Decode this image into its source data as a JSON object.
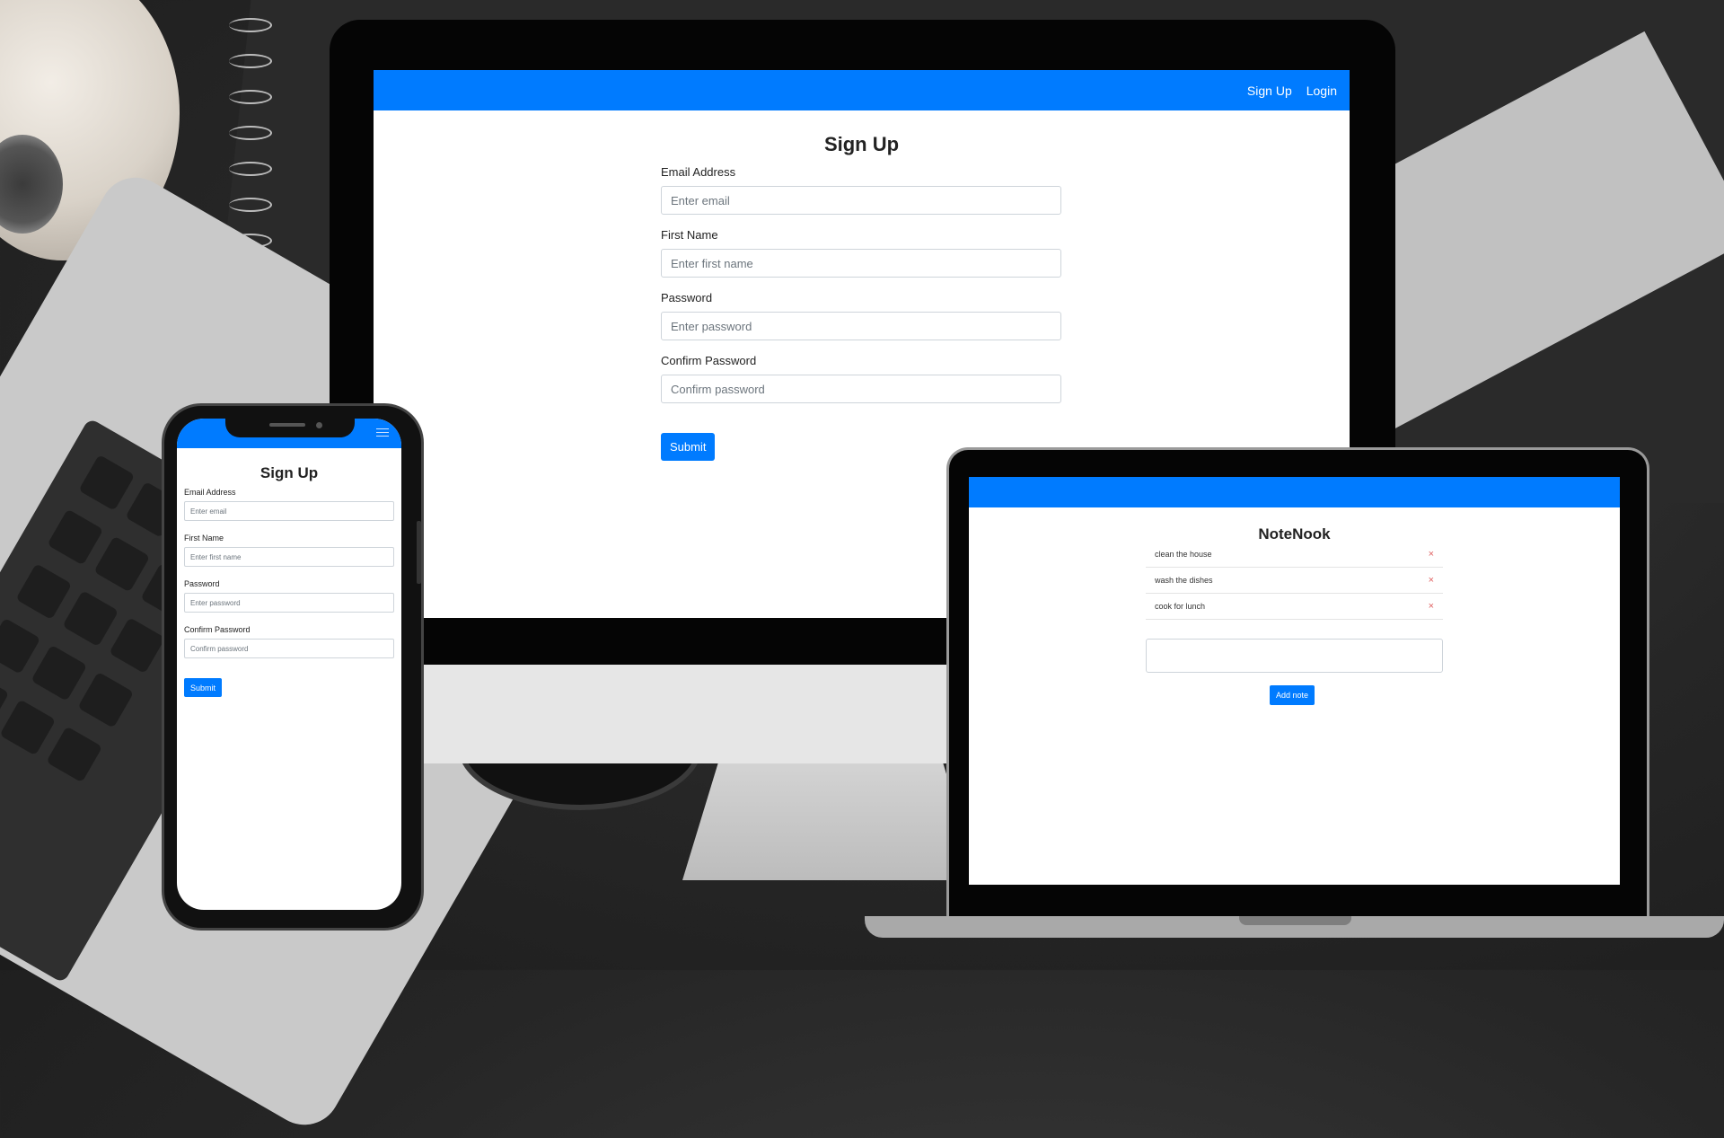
{
  "monitor": {
    "nav": {
      "signup": "Sign Up",
      "login": "Login"
    },
    "title": "Sign Up",
    "fields": [
      {
        "label": "Email Address",
        "placeholder": "Enter email"
      },
      {
        "label": "First Name",
        "placeholder": "Enter first name"
      },
      {
        "label": "Password",
        "placeholder": "Enter password"
      },
      {
        "label": "Confirm Password",
        "placeholder": "Confirm password"
      }
    ],
    "submit": "Submit"
  },
  "laptop": {
    "title": "NoteNook",
    "notes": [
      "clean the house",
      "wash the dishes",
      "cook for lunch"
    ],
    "delete_glyph": "×",
    "add_button": "Add note"
  },
  "phone": {
    "title": "Sign Up",
    "fields": [
      {
        "label": "Email Address",
        "placeholder": "Enter email"
      },
      {
        "label": "First Name",
        "placeholder": "Enter first name"
      },
      {
        "label": "Password",
        "placeholder": "Enter password"
      },
      {
        "label": "Confirm Password",
        "placeholder": "Confirm password"
      }
    ],
    "submit": "Submit"
  },
  "colors": {
    "primary": "#007bff",
    "danger": "#e06060"
  },
  "icons": {
    "phone_menu": "hamburger-menu-icon"
  }
}
